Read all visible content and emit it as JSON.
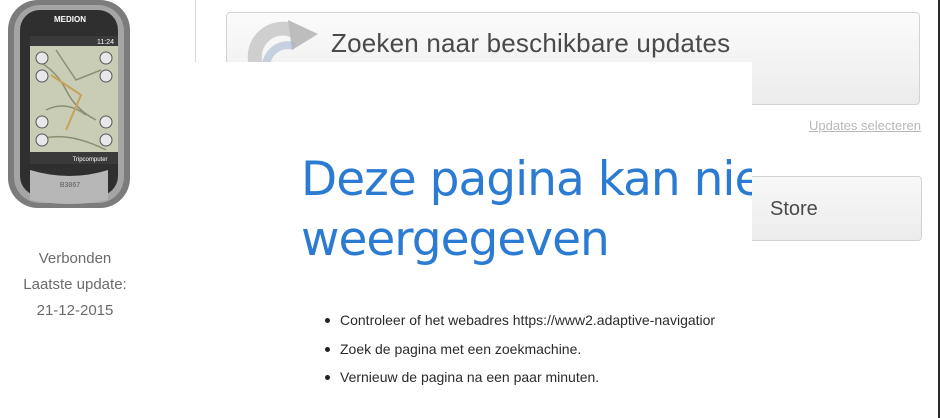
{
  "device": {
    "brand": "MEDION",
    "model": "B3867",
    "clock": "11:24",
    "map_button_label": "Tripcomputer",
    "status_lines": [
      "Verbonden",
      "Laatste update:",
      "21-12-2015"
    ]
  },
  "updates": {
    "search_label": "Zoeken naar beschikbare updates",
    "select_link": "Updates selecteren",
    "store_label": "Store"
  },
  "error": {
    "title_line1": "Deze pagina kan niet,",
    "title_line2": "weergegeven",
    "tips": [
      "Controleer of het webadres https://www2.adaptive-navigatior",
      "Zoek de pagina met een zoekmachine.",
      "Vernieuw de pagina na een paar minuten."
    ]
  },
  "colors": {
    "error_title": "#2b7bd3",
    "status_text": "#6b6b6b",
    "link_text": "#b8b8b8"
  }
}
